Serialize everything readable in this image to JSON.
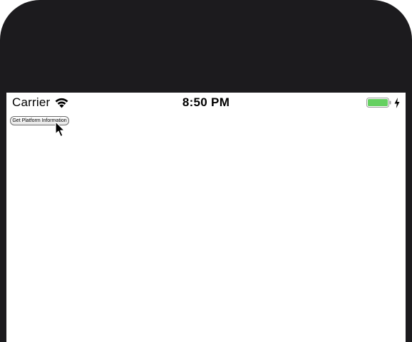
{
  "status_bar": {
    "carrier": "Carrier",
    "time": "8:50 PM",
    "wifi_icon": "wifi-icon",
    "battery_icon": "battery-icon",
    "charging_icon": "charging-bolt-icon",
    "battery_color": "#65d061"
  },
  "main": {
    "platform_button_label": "Get Platform Information"
  },
  "colors": {
    "device_frame": "#1c1b1e",
    "screen_background": "#ffffff"
  },
  "cursor_icon": "arrow-pointer-icon"
}
